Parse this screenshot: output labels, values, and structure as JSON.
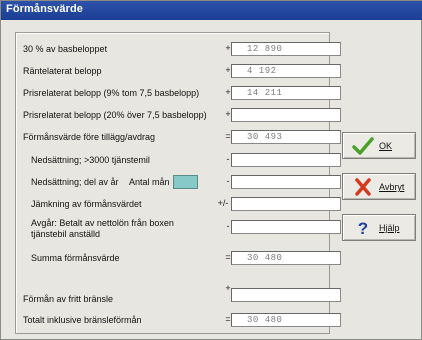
{
  "window": {
    "title": "Förmånsvärde"
  },
  "rows": {
    "r1": {
      "label": "30 % av basbeloppet",
      "op": "+",
      "value": "12 890"
    },
    "r2": {
      "label": "Räntelaterat belopp",
      "op": "+",
      "value": "4 192"
    },
    "r3": {
      "label": "Prisrelaterat belopp (9% tom 7,5 basbelopp)",
      "op": "+",
      "value": "14 211"
    },
    "r4": {
      "label": "Prisrelaterat belopp (20% över 7,5 basbelopp)",
      "op": "+",
      "value": ""
    },
    "r5": {
      "label": "Förmånsvärde före tillägg/avdrag",
      "op": "=",
      "value": "30 493"
    },
    "r6": {
      "label": "Nedsättning; >3000 tjänstemil",
      "op": "-",
      "value": ""
    },
    "r7": {
      "label": "Nedsättning; del av år",
      "op": "-",
      "value": "",
      "amount_label": "Antal mån",
      "amount_value": ""
    },
    "r8": {
      "label": "Jämkning av förmånsvärdet",
      "op": "+/-",
      "value": ""
    },
    "r9": {
      "label": "Avgår: Betalt av nettolön från boxen tjänstebil anställd",
      "op": "-",
      "value": ""
    },
    "r10": {
      "label": "Summa förmånsvärde",
      "op": "=",
      "value": "30 480"
    },
    "r11": {
      "label": "Förmån av fritt bränsle",
      "op": "+",
      "value": ""
    },
    "r12": {
      "label": "Totalt inklusive bränsleförmån",
      "op": "=",
      "value": "30 480"
    }
  },
  "buttons": {
    "ok": {
      "label": "OK",
      "icon": "checkmark-icon",
      "color": "#4aa028"
    },
    "cancel": {
      "label": "Avbryt",
      "icon": "x-icon",
      "color": "#d63a1e"
    },
    "help": {
      "label": "Hjälp",
      "icon": "question-mark-icon",
      "color": "#1f3fa0"
    }
  }
}
